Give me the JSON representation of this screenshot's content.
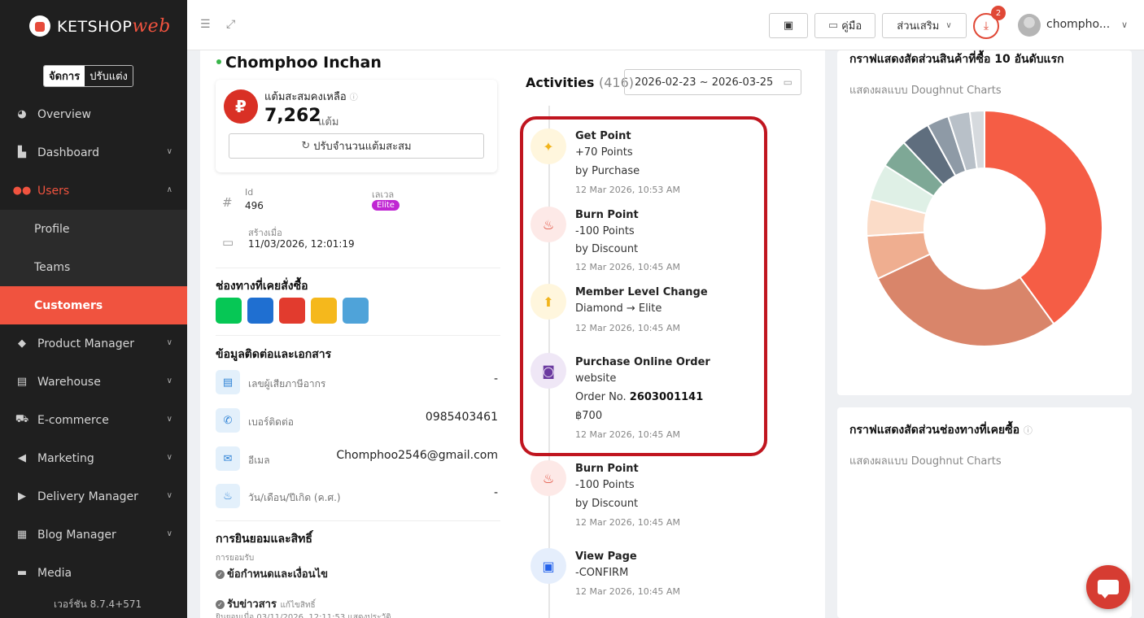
{
  "brand": {
    "name_main": "KETSHOP",
    "name_accent": "web"
  },
  "mode_toggle": {
    "manage": "จัดการ",
    "customize": "ปรับแต่ง"
  },
  "sidebar": {
    "items": [
      {
        "label": "Overview",
        "icon": "pie-chart-icon"
      },
      {
        "label": "Dashboard",
        "icon": "bar-chart-icon"
      },
      {
        "label": "Users",
        "icon": "users-icon"
      },
      {
        "label": "Product Manager",
        "icon": "tag-icon"
      },
      {
        "label": "Warehouse",
        "icon": "warehouse-icon"
      },
      {
        "label": "E-commerce",
        "icon": "cart-icon"
      },
      {
        "label": "Marketing",
        "icon": "megaphone-icon"
      },
      {
        "label": "Delivery Manager",
        "icon": "truck-icon"
      },
      {
        "label": "Blog Manager",
        "icon": "blog-icon"
      },
      {
        "label": "Media",
        "icon": "folder-icon"
      }
    ],
    "users_sub": [
      "Profile",
      "Teams",
      "Customers"
    ],
    "version": "เวอร์ชัน 8.7.4+571"
  },
  "topbar": {
    "guide_label": "คู่มือ",
    "addons_label": "ส่วนเสริม",
    "download_count": "2",
    "username": "chompho..."
  },
  "customer": {
    "name": "Chomphoo Inchan",
    "points_label": "แต้มสะสมคงเหลือ",
    "points_value": "7,262",
    "points_unit": "แต้ม",
    "adjust_button": "ปรับจำนวนแต้มสะสม",
    "id_label": "Id",
    "id_value": "496",
    "level_label": "เลเวล",
    "level_value": "Elite",
    "created_label": "สร้างเมื่อ",
    "created_value": "11/03/2026, 12:01:19",
    "channels_title": "ช่องทางที่เคยสั่งซื้อ",
    "contact_title": "ข้อมูลติดต่อและเอกสาร",
    "contacts": [
      {
        "label": "เลขผู้เสียภาษีอากร",
        "value": "-"
      },
      {
        "label": "เบอร์ติดต่อ",
        "value": "0985403461"
      },
      {
        "label": "อีเมล",
        "value": "Chomphoo2546@gmail.com"
      },
      {
        "label": "วัน/เดือน/ปีเกิด (ค.ศ.)",
        "value": "-"
      }
    ],
    "consent_title": "การยินยอมและสิทธิ์",
    "consent_label": "การยอมรับ",
    "consent_terms": "ข้อกำหนดและเงื่อนไข",
    "consent_news": "รับข่าวสาร",
    "consent_news_link": "แก้ไขสิทธิ์",
    "consent_news_note": "ยินยอมเมื่อ 03/11/2026, 12:11:53  แสดงประวัติ"
  },
  "activities": {
    "title": "Activities",
    "count": "(416)",
    "date_range": "2026-02-23 ~ 2026-03-25",
    "items": [
      {
        "title": "Get Point",
        "lines": [
          "+70 Points",
          "by Purchase"
        ],
        "time": "12 Mar 2026, 10:53 AM"
      },
      {
        "title": "Burn Point",
        "lines": [
          "-100 Points",
          "by Discount"
        ],
        "time": "12 Mar 2026, 10:45 AM"
      },
      {
        "title": "Member Level Change",
        "lines": [
          "Diamond → Elite"
        ],
        "time": "12 Mar 2026, 10:45 AM"
      },
      {
        "title": "Purchase Online Order",
        "lines": [
          "website"
        ],
        "order_prefix": "Order No. ",
        "order_no": "2603001141",
        "amount": "฿700",
        "time": "12 Mar 2026, 10:45 AM"
      },
      {
        "title": "Burn Point",
        "lines": [
          "-100 Points",
          "by Discount"
        ],
        "time": "12 Mar 2026, 10:45 AM"
      },
      {
        "title": "View Page",
        "lines": [
          "-CONFIRM"
        ],
        "time": "12 Mar 2026, 10:45 AM"
      }
    ]
  },
  "charts": {
    "top_products_title": "กราฟแสดงสัดส่วนสินค้าที่ซื้อ 10 อันดับแรก",
    "top_products_sub": "แสดงผลแบบ Doughnut Charts",
    "channels_title": "กราฟแสดงสัดส่วนช่องทางที่เคยซื้อ",
    "channels_sub": "แสดงผลแบบ Doughnut Charts",
    "slices": [
      {
        "value": 40,
        "color": "#f55d45"
      },
      {
        "value": 28,
        "color": "#d9856a"
      },
      {
        "value": 6,
        "color": "#efae90"
      },
      {
        "value": 5,
        "color": "#fbdcc8"
      },
      {
        "value": 5,
        "color": "#dff0e6"
      },
      {
        "value": 4,
        "color": "#7ea896"
      },
      {
        "value": 4,
        "color": "#5f6e7e"
      },
      {
        "value": 3,
        "color": "#8e9aa6"
      },
      {
        "value": 3,
        "color": "#b8c0c8"
      },
      {
        "value": 2,
        "color": "#d6dade"
      }
    ]
  }
}
